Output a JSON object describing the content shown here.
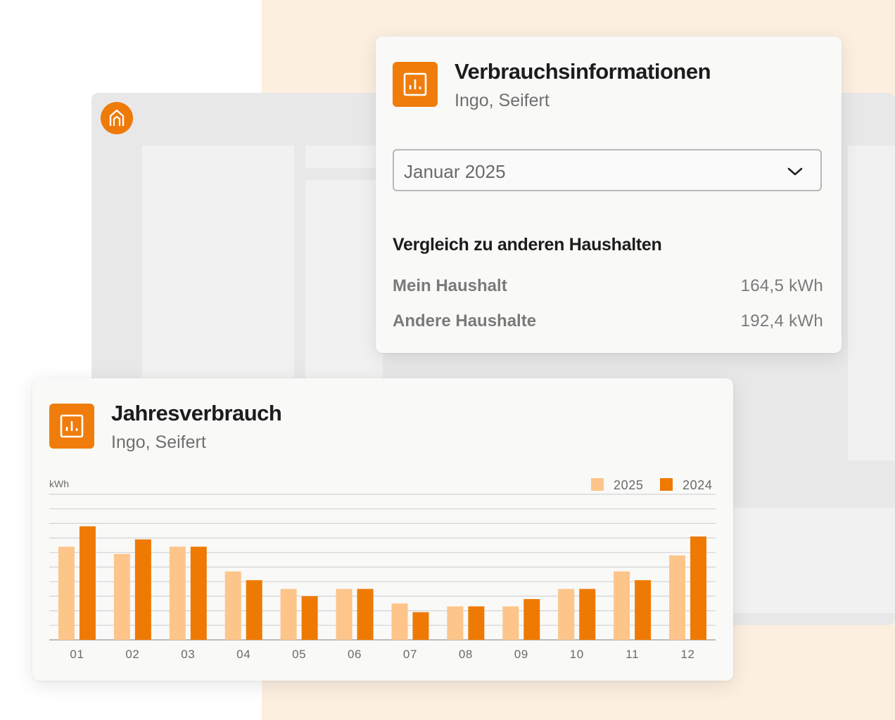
{
  "colors": {
    "accent": "#f07c0c",
    "series_2025": "#fdc58a",
    "series_2024": "#ee7a04",
    "peach_background": "#fdefe0"
  },
  "app_logo": {
    "icon": "house-icon"
  },
  "consumption_card": {
    "icon": "bar-chart-icon",
    "title": "Verbrauchsinformationen",
    "subtitle": "Ingo, Seifert",
    "month_select": {
      "value": "Januar 2025",
      "icon": "chevron-down-icon"
    },
    "comparison_title": "Vergleich zu anderen Haushalten",
    "rows": [
      {
        "label": "Mein Haushalt",
        "value": "164,5 kWh"
      },
      {
        "label": "Andere Haushalte",
        "value": "192,4 kWh"
      }
    ]
  },
  "annual_card": {
    "icon": "bar-chart-icon",
    "title": "Jahresverbrauch",
    "subtitle": "Ingo, Seifert"
  },
  "chart_data": {
    "type": "bar",
    "ylabel": "kWh",
    "ylim": [
      0,
      10
    ],
    "grid": true,
    "legend_position": "top-right",
    "categories": [
      "01",
      "02",
      "03",
      "04",
      "05",
      "06",
      "07",
      "08",
      "09",
      "10",
      "11",
      "12"
    ],
    "series": [
      {
        "name": "2025",
        "values": [
          6.4,
          5.9,
          6.4,
          4.7,
          3.5,
          3.5,
          2.5,
          2.3,
          2.3,
          3.5,
          4.7,
          5.8
        ]
      },
      {
        "name": "2024",
        "values": [
          7.8,
          6.9,
          6.4,
          4.1,
          3.0,
          3.5,
          1.9,
          2.3,
          2.8,
          3.5,
          4.1,
          7.1
        ]
      }
    ]
  }
}
